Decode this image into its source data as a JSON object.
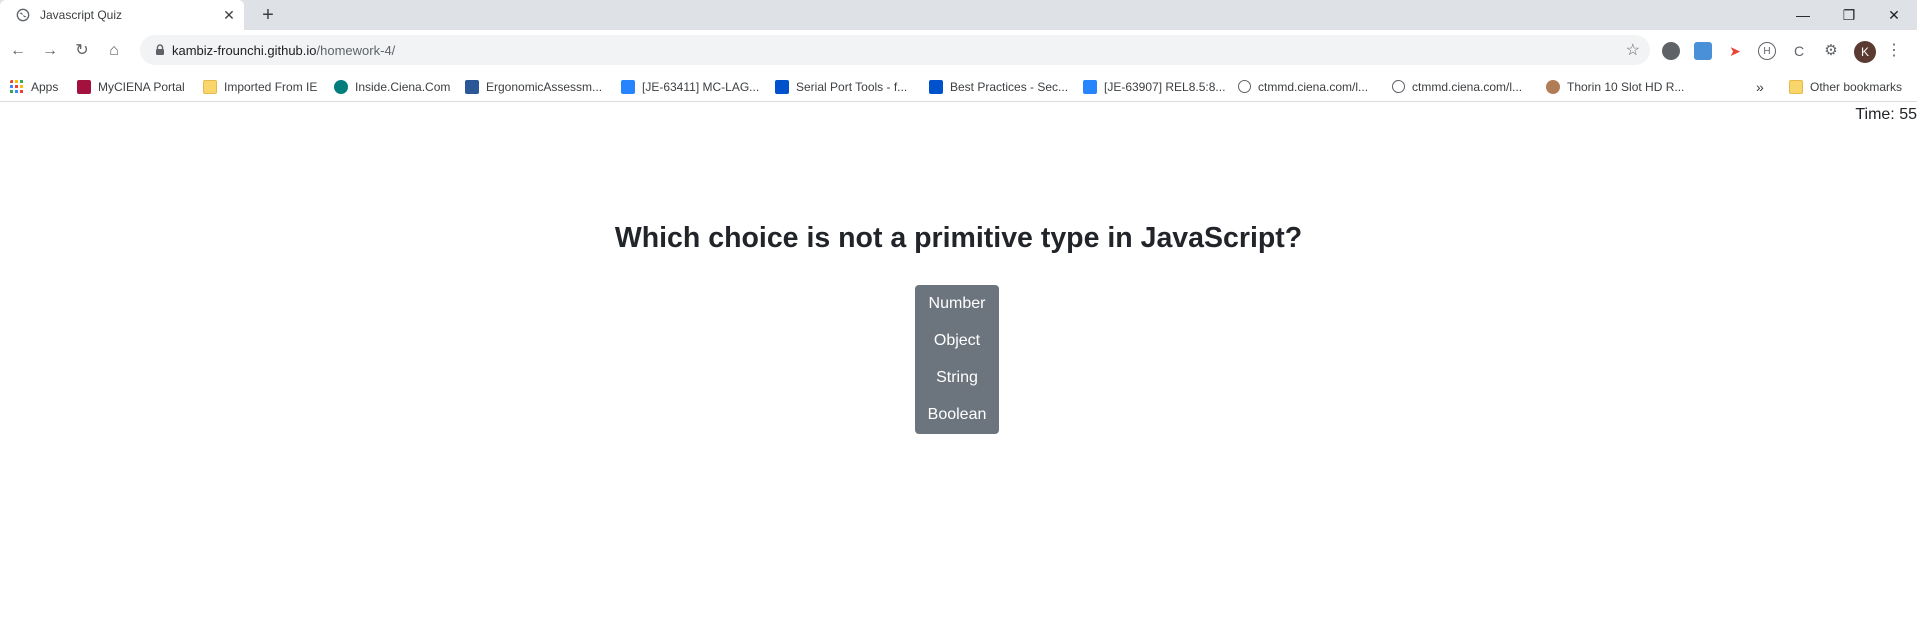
{
  "browser": {
    "tab_title": "Javascript Quiz",
    "tab_close": "✕",
    "new_tab": "+",
    "window_controls": {
      "minimize": "—",
      "restore": "❐",
      "close": "✕"
    },
    "url_host": "kambiz-frounchi.github.io",
    "url_path": "/homework-4/",
    "profile_initial": "K",
    "bookmarks": [
      {
        "label": "Apps",
        "icon": "apps-grid-icon",
        "color": "#ea4335"
      },
      {
        "label": "MyCIENA Portal",
        "icon": "ciena-icon",
        "color": "#a3123f"
      },
      {
        "label": "Imported From IE",
        "icon": "folder-icon",
        "color": "#f9d66b"
      },
      {
        "label": "Inside.Ciena.Com",
        "icon": "sharepoint-icon",
        "color": "#037c7c"
      },
      {
        "label": "ErgonomicAssessm...",
        "icon": "word-icon",
        "color": "#2b5797"
      },
      {
        "label": "[JE-63411] MC-LAG...",
        "icon": "jira-probot-icon",
        "color": "#2684ff"
      },
      {
        "label": "Serial Port Tools - f...",
        "icon": "confluence-icon",
        "color": "#0052cc"
      },
      {
        "label": "Best Practices - Sec...",
        "icon": "confluence-icon",
        "color": "#0052cc"
      },
      {
        "label": "[JE-63907] REL8.5:8...",
        "icon": "jira-probot-icon",
        "color": "#2684ff"
      },
      {
        "label": "ctmmd.ciena.com/l...",
        "icon": "globe-icon",
        "color": "#5f6368"
      },
      {
        "label": "ctmmd.ciena.com/l...",
        "icon": "globe-icon",
        "color": "#5f6368"
      },
      {
        "label": "Thorin 10 Slot HD R...",
        "icon": "person-icon",
        "color": "#b07d56"
      }
    ],
    "overflow": "»",
    "other_bookmarks": "Other bookmarks"
  },
  "page": {
    "timer": "Time: 55",
    "question": "Which choice is not a primitive type in JavaScript?",
    "choices": [
      "Number",
      "Object",
      "String",
      "Boolean"
    ]
  }
}
